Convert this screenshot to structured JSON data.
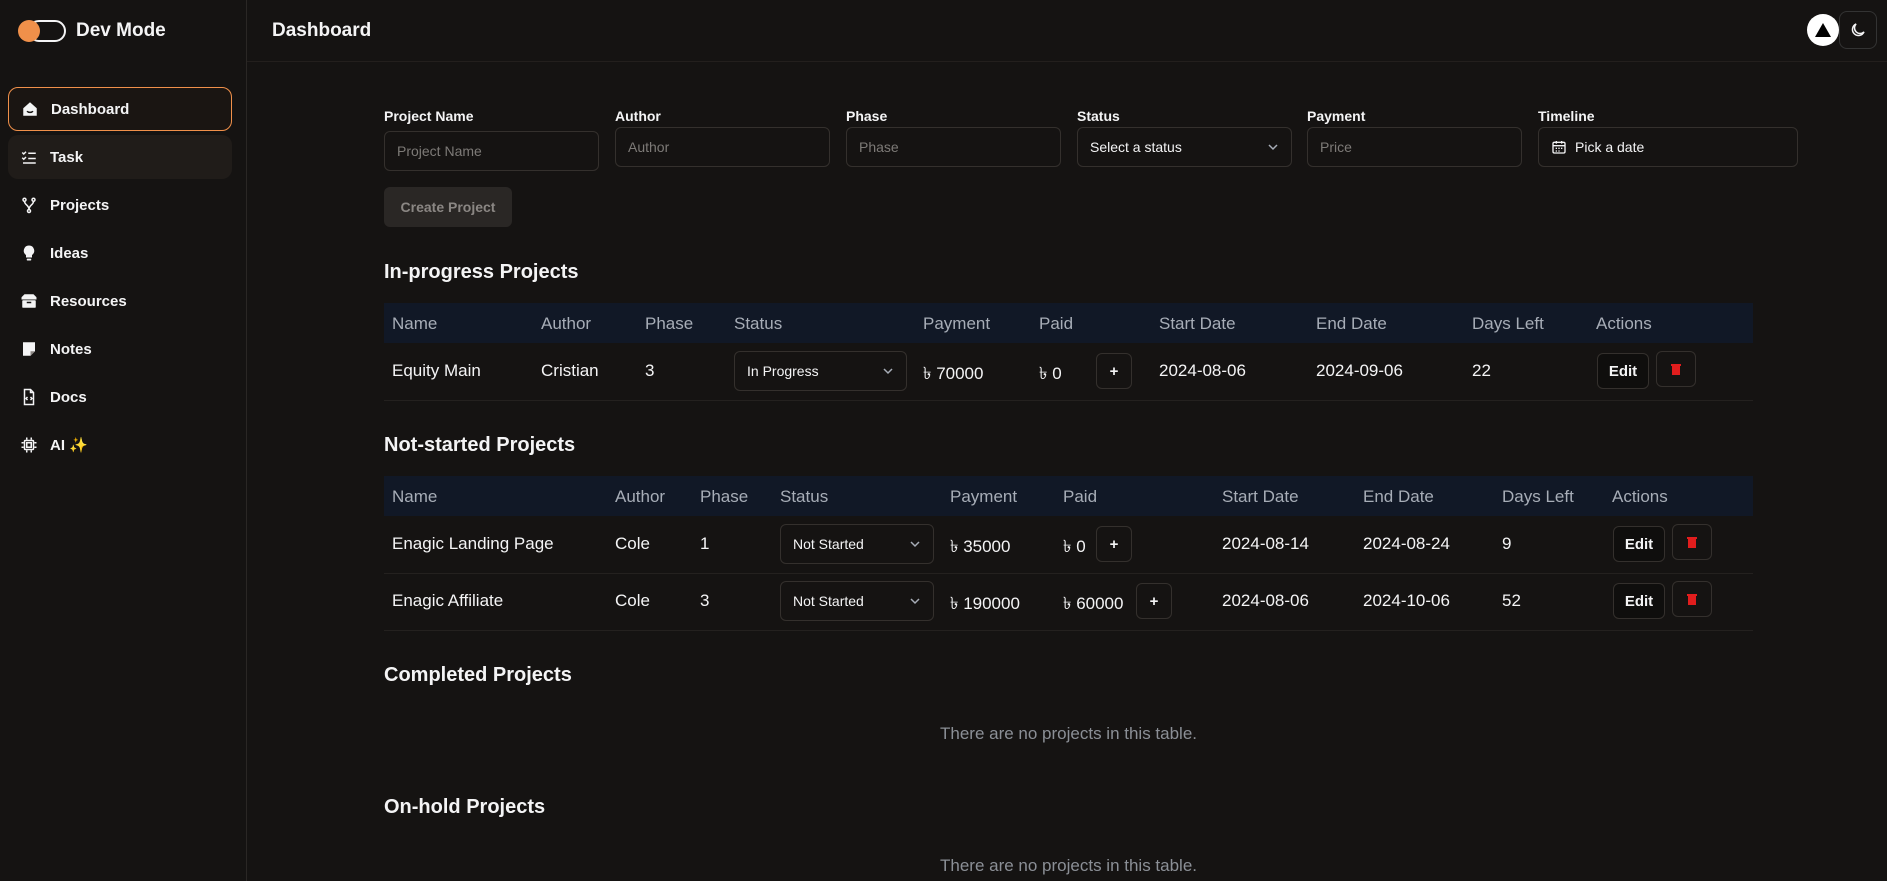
{
  "brand": {
    "title": "Dev Mode",
    "accent": "#f0904a"
  },
  "sidebar": {
    "items": [
      {
        "label": "Dashboard",
        "icon": "home-icon"
      },
      {
        "label": "Task",
        "icon": "checklist-icon"
      },
      {
        "label": "Projects",
        "icon": "branch-icon"
      },
      {
        "label": "Ideas",
        "icon": "lightbulb-icon"
      },
      {
        "label": "Resources",
        "icon": "box-icon"
      },
      {
        "label": "Notes",
        "icon": "sticky-note-icon"
      },
      {
        "label": "Docs",
        "icon": "code-file-icon"
      },
      {
        "label": "AI ✨",
        "icon": "cpu-icon"
      }
    ]
  },
  "header": {
    "title": "Dashboard"
  },
  "form": {
    "project_name": {
      "label": "Project Name",
      "placeholder": "Project Name"
    },
    "author": {
      "label": "Author",
      "placeholder": "Author"
    },
    "phase": {
      "label": "Phase",
      "placeholder": "Phase"
    },
    "status": {
      "label": "Status",
      "value": "Select a status"
    },
    "payment": {
      "label": "Payment",
      "placeholder": "Price"
    },
    "timeline": {
      "label": "Timeline",
      "value": "Pick a date"
    },
    "create_label": "Create Project"
  },
  "in_progress": {
    "title": "In-progress Projects",
    "columns": [
      "Name",
      "Author",
      "Phase",
      "Status",
      "Payment",
      "Paid",
      "Start Date",
      "End Date",
      "Days Left",
      "Actions"
    ],
    "rows": [
      {
        "name": "Equity Main",
        "author": "Cristian",
        "phase": "3",
        "status": "In Progress",
        "payment": "৳ 70000",
        "paid": "৳ 0",
        "start": "2024-08-06",
        "end": "2024-09-06",
        "days_left": "22"
      }
    ]
  },
  "not_started": {
    "title": "Not-started Projects",
    "columns": [
      "Name",
      "Author",
      "Phase",
      "Status",
      "Payment",
      "Paid",
      "Start Date",
      "End Date",
      "Days Left",
      "Actions"
    ],
    "rows": [
      {
        "name": "Enagic Landing Page",
        "author": "Cole",
        "phase": "1",
        "status": "Not Started",
        "payment": "৳ 35000",
        "paid": "৳ 0",
        "start": "2024-08-14",
        "end": "2024-08-24",
        "days_left": "9"
      },
      {
        "name": "Enagic Affiliate",
        "author": "Cole",
        "phase": "3",
        "status": "Not Started",
        "payment": "৳ 190000",
        "paid": "৳ 60000",
        "start": "2024-08-06",
        "end": "2024-10-06",
        "days_left": "52"
      }
    ]
  },
  "completed": {
    "title": "Completed Projects",
    "empty_text": "There are no projects in this table."
  },
  "on_hold": {
    "title": "On-hold Projects",
    "empty_text": "There are no projects in this table."
  },
  "buttons": {
    "plus": "+",
    "edit": "Edit"
  },
  "colors": {
    "background": "#151312",
    "table_header": "#111826",
    "delete": "#e11d1d"
  }
}
